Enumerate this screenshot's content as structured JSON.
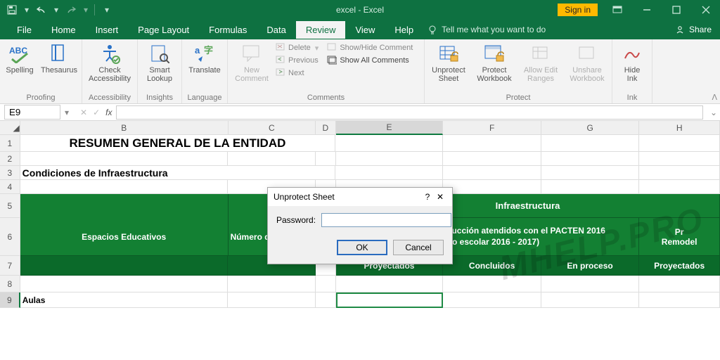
{
  "title": "excel - Excel",
  "signin": "Sign in",
  "menus": [
    "File",
    "Home",
    "Insert",
    "Page Layout",
    "Formulas",
    "Data",
    "Review",
    "View",
    "Help"
  ],
  "tellme": "Tell me what you want to do",
  "share": "Share",
  "ribbon": {
    "g1": {
      "label": "Proofing",
      "spelling": "Spelling",
      "thesaurus": "Thesaurus"
    },
    "g2": {
      "label": "Accessibility",
      "b": "Check\nAccessibility"
    },
    "g3": {
      "label": "Insights",
      "b": "Smart\nLookup"
    },
    "g4": {
      "label": "Language",
      "b": "Translate"
    },
    "g5": {
      "label": "Comments",
      "new": "New\nComment",
      "delete": "Delete",
      "prev": "Previous",
      "next": "Next",
      "shc": "Show/Hide Comment",
      "sac": "Show All Comments"
    },
    "g6": {
      "label": "Protect",
      "us": "Unprotect\nSheet",
      "pw": "Protect\nWorkbook",
      "ae": "Allow Edit\nRanges",
      "uw": "Unshare\nWorkbook"
    },
    "g7": {
      "label": "Ink",
      "b": "Hide\nInk"
    }
  },
  "namebox": "E9",
  "cols": {
    "B": 310,
    "C": 130,
    "D": 30,
    "E": 160,
    "F": 146,
    "G": 146,
    "H": 120
  },
  "rows": [
    "1",
    "2",
    "3",
    "4",
    "5",
    "6",
    "7",
    "8",
    "9"
  ],
  "sheet": {
    "title": "RESUMEN GENERAL DE LA ENTIDAD",
    "subtitle": "Condiciones de Infraestructura",
    "h_espacios": "Espacios Educativos",
    "h_num": "Número de espacios",
    "h_infra": "Infraestructura",
    "h_proy_pacten": "Proyectos de Construcción atendidos con el PACTEN 2016\n(ciclo escolar 2016 - 2017)",
    "h_pr": "Pr",
    "h_remodel": "Remodel",
    "h_proyectados": "Proyectados",
    "h_concluidos": "Concluidos",
    "h_enproc": "En proceso",
    "h_proyectados2": "Proyectados",
    "aulas": "Aulas"
  },
  "dialog": {
    "title": "Unprotect Sheet",
    "pw": "Password:",
    "ok": "OK",
    "cancel": "Cancel"
  },
  "watermark": "MHELP.PRO"
}
